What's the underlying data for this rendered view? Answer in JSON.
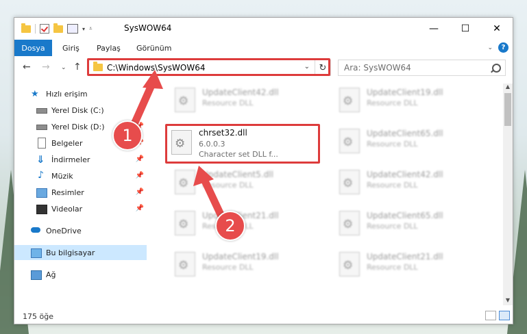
{
  "window": {
    "title": "SysWOW64"
  },
  "ribbon": {
    "tabs": [
      "Dosya",
      "Giriş",
      "Paylaş",
      "Görünüm"
    ],
    "help_label": "?"
  },
  "nav": {
    "address": "C:\\Windows\\SysWOW64",
    "search_placeholder": "Ara: SysWOW64"
  },
  "sidebar": {
    "items": [
      {
        "label": "Hızlı erişim",
        "icon": "star-icon"
      },
      {
        "label": "Yerel Disk (C:)",
        "icon": "drive-icon"
      },
      {
        "label": "Yerel Disk (D:)",
        "icon": "drive-icon"
      },
      {
        "label": "Belgeler",
        "icon": "document-icon"
      },
      {
        "label": "İndirmeler",
        "icon": "download-icon"
      },
      {
        "label": "Müzik",
        "icon": "music-icon"
      },
      {
        "label": "Resimler",
        "icon": "picture-icon"
      },
      {
        "label": "Videolar",
        "icon": "video-icon"
      },
      {
        "label": "OneDrive",
        "icon": "cloud-icon"
      },
      {
        "label": "Bu bilgisayar",
        "icon": "computer-icon"
      },
      {
        "label": "Ağ",
        "icon": "network-icon"
      }
    ]
  },
  "files": {
    "left": [
      {
        "name": "UpdateClient42.dll",
        "type": "Resource DLL"
      },
      {
        "name": "chrset32.dll",
        "version": "6.0.0.3",
        "description": "Character set DLL f..."
      },
      {
        "name": "UpdateClient5.dll",
        "type": "Resource DLL"
      },
      {
        "name": "UpdateClient21.dll",
        "type": "Resource DLL"
      },
      {
        "name": "UpdateClient19.dll",
        "type": "Resource DLL"
      }
    ],
    "right": [
      {
        "name": "UpdateClient19.dll",
        "type": "Resource DLL"
      },
      {
        "name": "UpdateClient65.dll",
        "type": "Resource DLL"
      },
      {
        "name": "UpdateClient42.dll",
        "type": "Resource DLL"
      },
      {
        "name": "UpdateClient65.dll",
        "type": "Resource DLL"
      },
      {
        "name": "UpdateClient21.dll",
        "type": "Resource DLL"
      }
    ]
  },
  "status": {
    "count": "175 öğe"
  },
  "annotations": {
    "step1": "1",
    "step2": "2"
  },
  "colors": {
    "accent": "#1979ca",
    "highlight": "#dd3b3b",
    "selected": "#cce8ff"
  }
}
